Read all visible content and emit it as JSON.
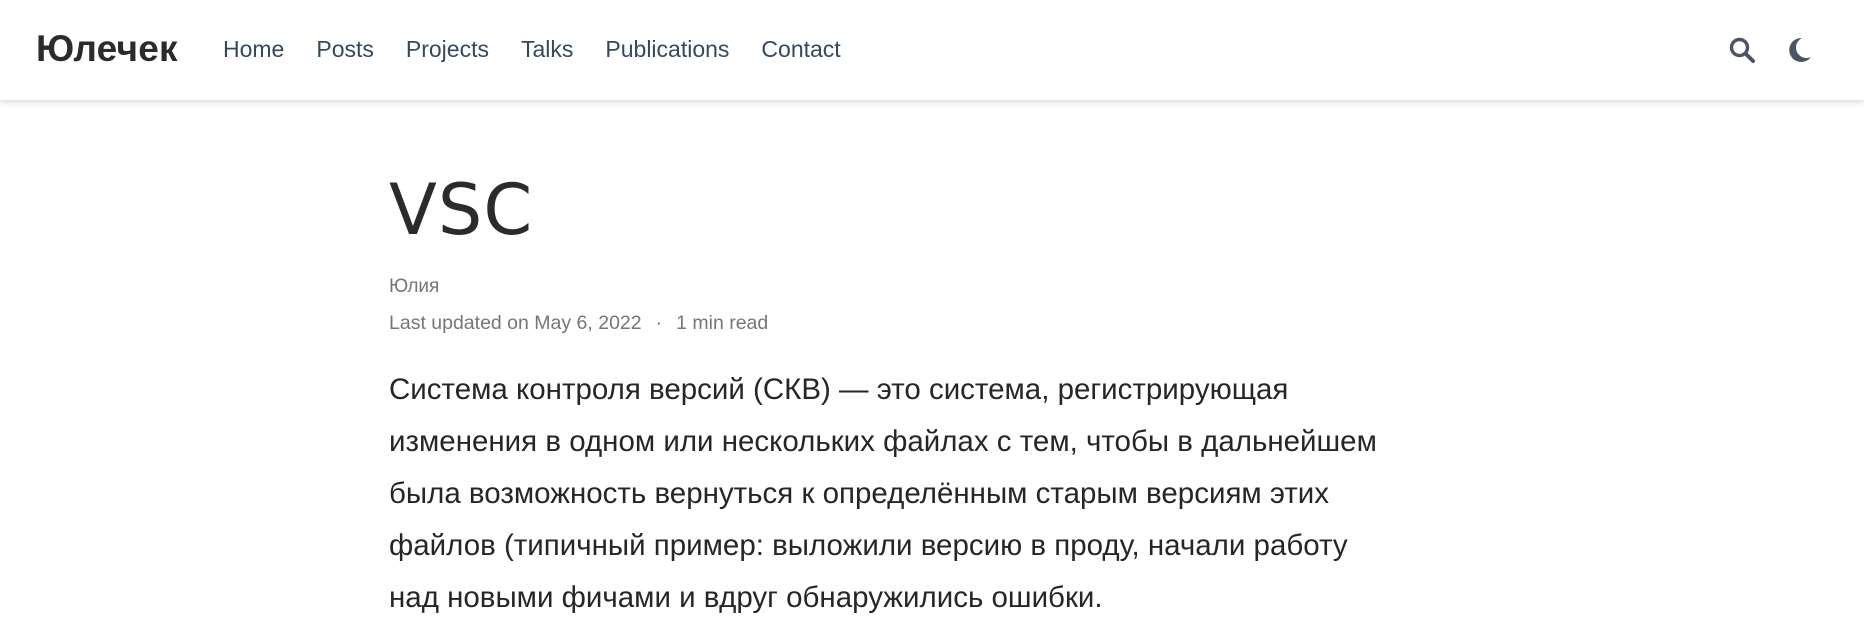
{
  "navbar": {
    "brand": "Юлечек",
    "links": [
      {
        "label": "Home"
      },
      {
        "label": "Posts"
      },
      {
        "label": "Projects"
      },
      {
        "label": "Talks"
      },
      {
        "label": "Publications"
      },
      {
        "label": "Contact"
      }
    ],
    "tools": {
      "search_icon": "search-icon",
      "theme_icon": "moon-icon"
    }
  },
  "article": {
    "title": "VSC",
    "author": "Юлия",
    "last_updated": "Last updated on May 6, 2022",
    "separator": "·",
    "read_time": "1 min read",
    "lines": [
      "Система контроля версий (СКВ) — это система, регистрирующая",
      "изменения в одном или нескольких файлах с тем, чтобы в дальнейшем",
      "была возможность вернуться к определённым старым версиям этих",
      "файлов (типичный пример: выложили версию в проду, начали работу",
      "над новыми фичами и вдруг обнаружились ошибки."
    ]
  },
  "colors": {
    "nav_text": "#34495e",
    "text": "#2b2b2b",
    "muted": "#767676",
    "background": "#ffffff"
  }
}
